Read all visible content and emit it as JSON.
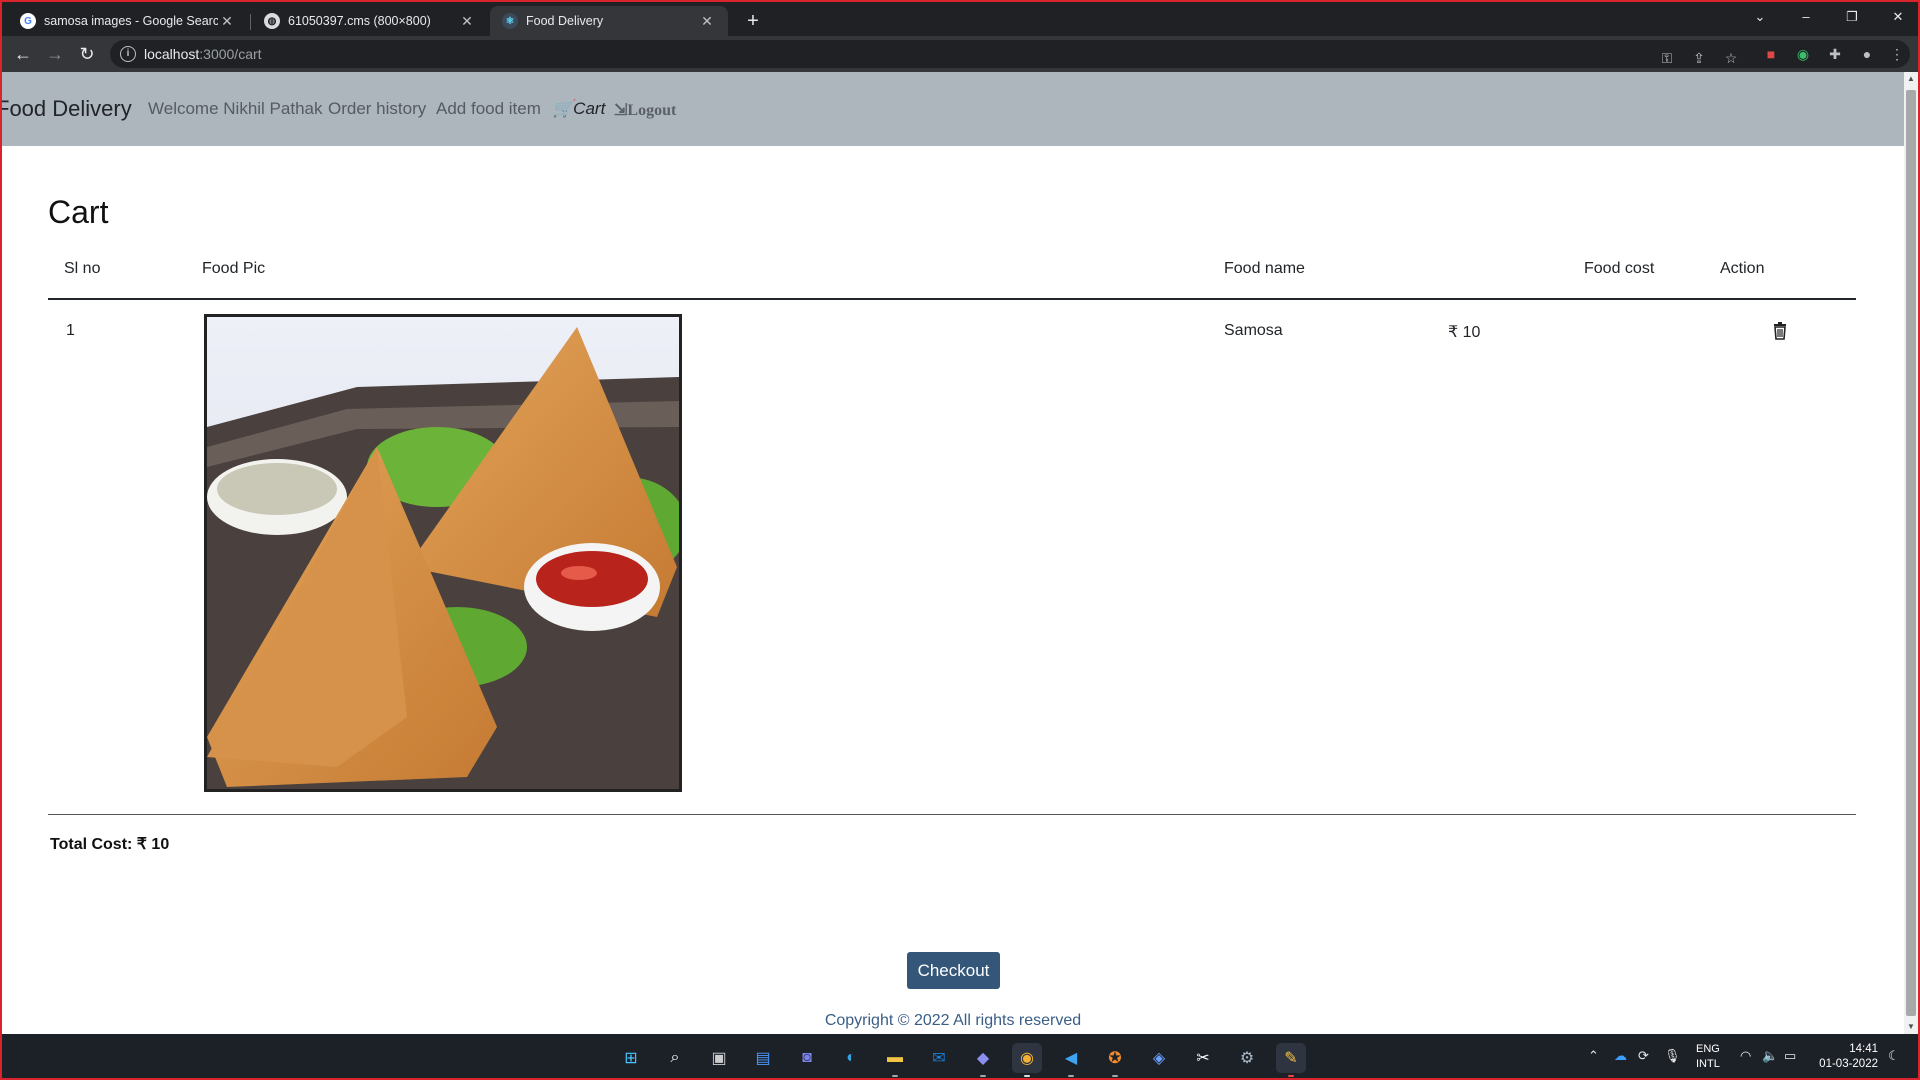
{
  "browser": {
    "tabs": [
      {
        "title": "samosa images - Google Search",
        "active": false
      },
      {
        "title": "61050397.cms (800×800)",
        "active": false
      },
      {
        "title": "Food Delivery",
        "active": true
      }
    ],
    "url_host": "localhost",
    "url_path": ":3000/cart",
    "accent_frame_color": "#d9232d"
  },
  "nav": {
    "brand": "Food Delivery",
    "welcome": "Welcome Nikhil Pathak",
    "order_history": "Order history",
    "add_food": "Add food item",
    "cart": "Cart",
    "logout": "Logout"
  },
  "cart": {
    "title": "Cart",
    "columns": {
      "sl_no": "Sl no",
      "food_pic": "Food Pic",
      "food_name": "Food name",
      "food_cost": "Food cost",
      "action": "Action"
    },
    "items": [
      {
        "sl_no": "1",
        "food_name": "Samosa",
        "food_cost": "₹ 10",
        "action_icon": "trash-icon"
      }
    ],
    "total": "Total Cost: ₹ 10",
    "checkout_label": "Checkout"
  },
  "footer": {
    "copyright": "Copyright © 2022 All rights reserved"
  },
  "taskbar": {
    "lang_line1": "ENG",
    "lang_line2": "INTL",
    "time": "14:41",
    "date": "01-03-2022"
  }
}
